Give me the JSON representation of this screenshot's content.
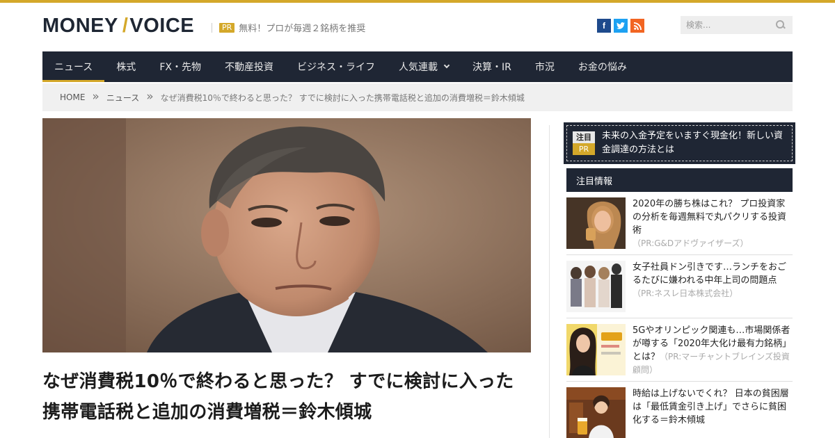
{
  "header": {
    "logo_left": "MONEY",
    "logo_slash": "/",
    "logo_right": "VOICE",
    "pr_badge": "PR",
    "pr_text": "無料！プロが毎週２銘柄を推奨",
    "social": {
      "facebook": "f",
      "twitter": "t",
      "rss": "rss"
    },
    "search_placeholder": "検索..."
  },
  "nav": {
    "items": [
      {
        "label": "ニュース"
      },
      {
        "label": "株式"
      },
      {
        "label": "FX・先物"
      },
      {
        "label": "不動産投資"
      },
      {
        "label": "ビジネス・ライフ"
      },
      {
        "label": "人気連載"
      },
      {
        "label": "決算・IR"
      },
      {
        "label": "市況"
      },
      {
        "label": "お金の悩み"
      }
    ]
  },
  "breadcrumb": {
    "home": "HOME",
    "sep": "»",
    "category": "ニュース",
    "current": "なぜ消費税10％で終わると思った？ すでに検討に入った携帯電話税と追加の消費増税＝鈴木傾城"
  },
  "article": {
    "title": "なぜ消費税10％で終わると思った？ すでに検討に入った携帯電話税と追加の消費増税＝鈴木傾城"
  },
  "sidebar": {
    "notice": {
      "tag": "注目",
      "pr": "PR",
      "text": "未来の入金予定をいますぐ現金化！新しい資金調達の方法とは"
    },
    "section_title": "注目情報",
    "items": [
      {
        "text": "2020年の勝ち株はこれ？ プロ投資家の分析を毎週無料で丸パクリする投資術",
        "sponsor": "（PR:G&Dアドヴァイザーズ）"
      },
      {
        "text": "女子社員ドン引きです…ランチをおごるたびに嫌われる中年上司の問題点",
        "sponsor": "（PR:ネスレ日本株式会社）"
      },
      {
        "text": "5Gやオリンピック関連も…市場関係者が噂する「2020年大化け最有力銘柄」とは？",
        "sponsor": "（PR:マーチャントブレインズ投資顧問）"
      },
      {
        "text": "時給は上げないでくれ？ 日本の貧困層は「最低賃金引き上げ」でさらに貧困化する＝鈴木傾城",
        "sponsor": ""
      }
    ]
  },
  "colors": {
    "accent": "#d4a82a",
    "nav_bg": "#1f2634",
    "breadcrumb_bg": "#f0f0f0"
  }
}
